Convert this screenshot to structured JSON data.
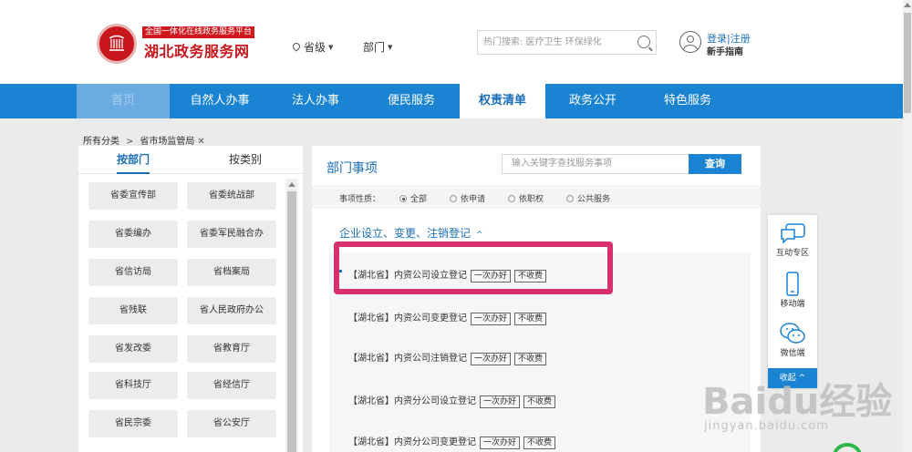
{
  "header": {
    "logo_tag": "全国一体化在线政务服务平台",
    "logo_title": "湖北政务服务网",
    "location_province": "省级",
    "location_department": "部门",
    "search_placeholder": "热门搜索: 医疗卫生 环保绿化",
    "login": "登录",
    "register": "注册",
    "login_sep": "|",
    "guide": "新手指南"
  },
  "nav": {
    "items": [
      {
        "label": "首页"
      },
      {
        "label": "自然人办事"
      },
      {
        "label": "法人办事"
      },
      {
        "label": "便民服务"
      },
      {
        "label": "权责清单"
      },
      {
        "label": "政务公开"
      },
      {
        "label": "特色服务"
      }
    ]
  },
  "breadcrumb": {
    "root": "所有分类",
    "sep": ">",
    "current": "省市场监管局",
    "close": "✕"
  },
  "left_panel": {
    "tabs": [
      {
        "label": "按部门"
      },
      {
        "label": "按类别"
      }
    ],
    "departments": [
      "省委宣传部",
      "省委统战部",
      "省委编办",
      "省委军民融合办",
      "省信访局",
      "省档案局",
      "省残联",
      "省人民政府办公",
      "省发改委",
      "省教育厅",
      "省科技厅",
      "省经信厅",
      "省民宗委",
      "省公安厅"
    ]
  },
  "main_panel": {
    "title": "部门事项",
    "keyword_placeholder": "输入关键字查找服务事项",
    "query_button": "查询",
    "filter_label": "事项性质：",
    "filter_options": [
      {
        "label": "全部",
        "selected": true
      },
      {
        "label": "依申请",
        "selected": false
      },
      {
        "label": "依职权",
        "selected": false
      },
      {
        "label": "公共服务",
        "selected": false
      }
    ],
    "group_title": "企业设立、变更、注销登记",
    "group_chevron": "^",
    "items": [
      {
        "name": "【湖北省】内资公司设立登记",
        "tag1": "一次办好",
        "tag2": "不收费"
      },
      {
        "name": "【湖北省】内资公司变更登记",
        "tag1": "一次办好",
        "tag2": "不收费"
      },
      {
        "name": "【湖北省】内资公司注销登记",
        "tag1": "一次办好",
        "tag2": "不收费"
      },
      {
        "name": "【湖北省】内资分公司设立登记",
        "tag1": "一次办好",
        "tag2": "不收费"
      },
      {
        "name": "【湖北省】内资分公司变更登记",
        "tag1": "一次办好",
        "tag2": "不收费"
      }
    ]
  },
  "side_bar": {
    "items": [
      {
        "label": "互动专区",
        "icon": "chat-bubble-icon"
      },
      {
        "label": "移动端",
        "icon": "mobile-phone-icon"
      },
      {
        "label": "微信端",
        "icon": "wechat-icon"
      }
    ],
    "collapse": "收起"
  },
  "watermark": {
    "text": "Baidu经验",
    "url": "jingyan.baidu.com"
  },
  "colors": {
    "brand_red": "#c8161d",
    "nav_blue": "#1a84d2",
    "link_blue": "#1b6fba",
    "highlight_pink": "#d8306f"
  }
}
